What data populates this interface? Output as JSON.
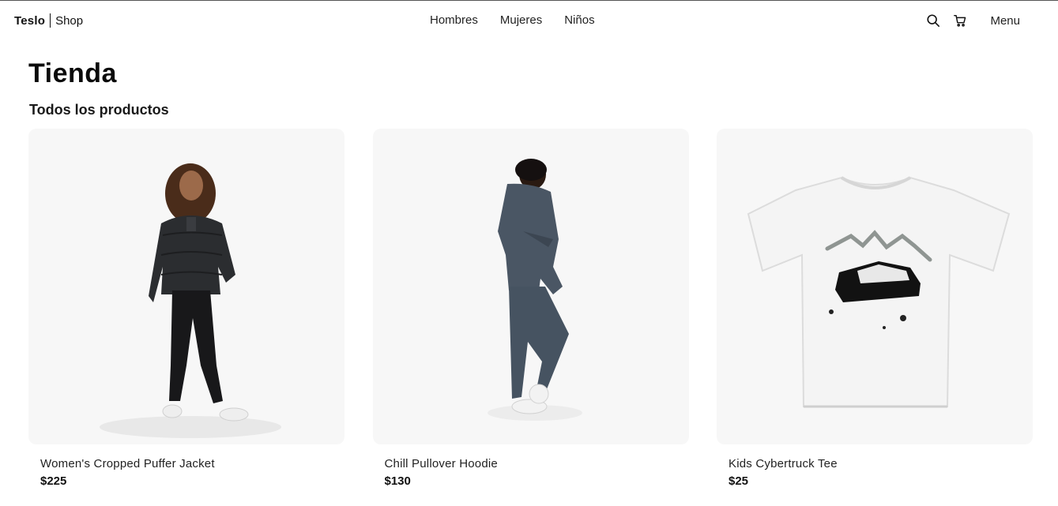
{
  "navbar": {
    "brand": {
      "name": "Teslo",
      "sub": "Shop"
    },
    "links": [
      {
        "label": "Hombres"
      },
      {
        "label": "Mujeres"
      },
      {
        "label": "Niños"
      }
    ],
    "icons": [
      "search-icon",
      "cart-icon"
    ],
    "menu_label": "Menu"
  },
  "page": {
    "title": "Tienda",
    "subtitle": "Todos los productos"
  },
  "products": [
    {
      "title": "Women's Cropped Puffer Jacket",
      "price": "$225",
      "image": "woman-puffer-jacket-image"
    },
    {
      "title": "Chill Pullover Hoodie",
      "price": "$130",
      "image": "man-hoodie-image"
    },
    {
      "title": "Kids Cybertruck Tee",
      "price": "$25",
      "image": "cybertruck-tee-image"
    }
  ],
  "colors": {
    "card_bg": "#f7f7f7",
    "text": "#111111"
  }
}
